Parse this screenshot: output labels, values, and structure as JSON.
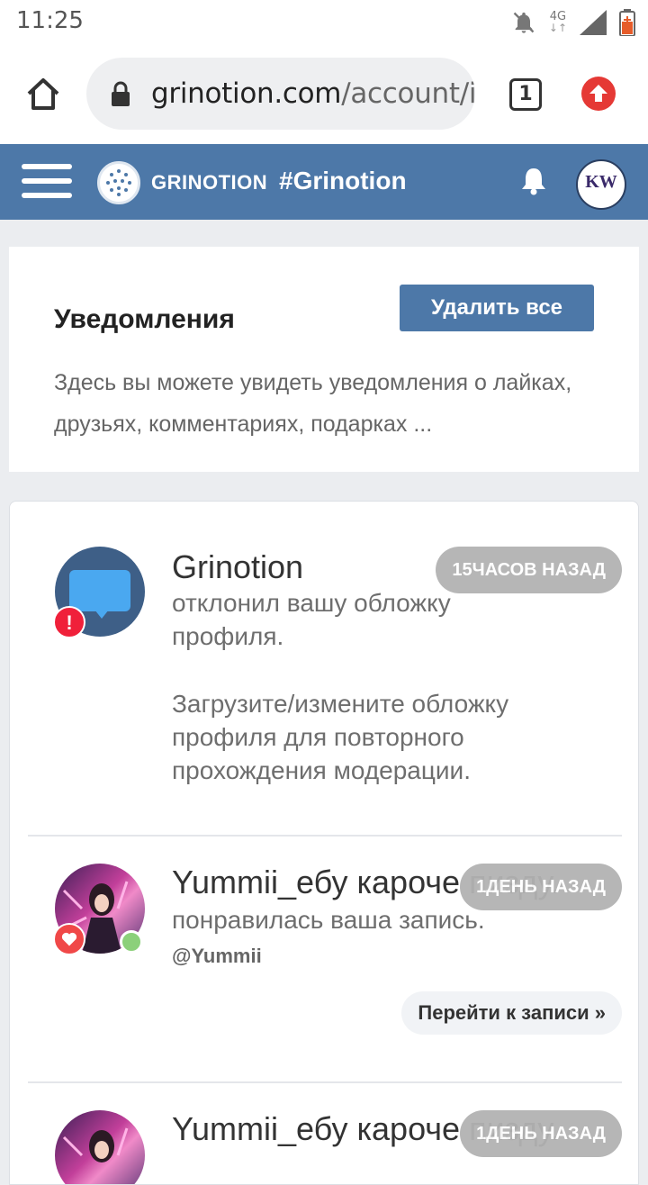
{
  "status_bar": {
    "time": "11:25",
    "network": "4G"
  },
  "browser": {
    "url_domain": "grinotion.com",
    "url_path": "/account/i",
    "tab_count": "1"
  },
  "site_header": {
    "logo_text": "GRINOTION",
    "hashtag": "#Grinotion",
    "avatar_text": "KW"
  },
  "notifications_header": {
    "title": "Уведомления",
    "delete_all_label": "Удалить все",
    "description": "Здесь вы можете увидеть уведомления о лайках, друзьях, комментариях, подарках ..."
  },
  "notifications": [
    {
      "name": "Grinotion",
      "time": "15ЧАСОВ НАЗАД",
      "text": "отклонил вашу обложку профиля.",
      "extra": "Загрузите/измените обложку профиля для повторного прохождения модерации.",
      "badge": "!"
    },
    {
      "name": "Yummii_ебу кароче пизду.",
      "time": "1ДЕНЬ НАЗАД",
      "text": "понравилась ваша запись.",
      "mention": "@Yummii",
      "action": "Перейти к записи »"
    },
    {
      "name": "Yummii_ебу кароче пизду.",
      "time": "1ДЕНЬ НАЗАД"
    }
  ],
  "colors": {
    "brand": "#4d78a8",
    "alert_badge": "#f0203a",
    "like_badge": "#f04848",
    "online": "#8bd07a"
  }
}
